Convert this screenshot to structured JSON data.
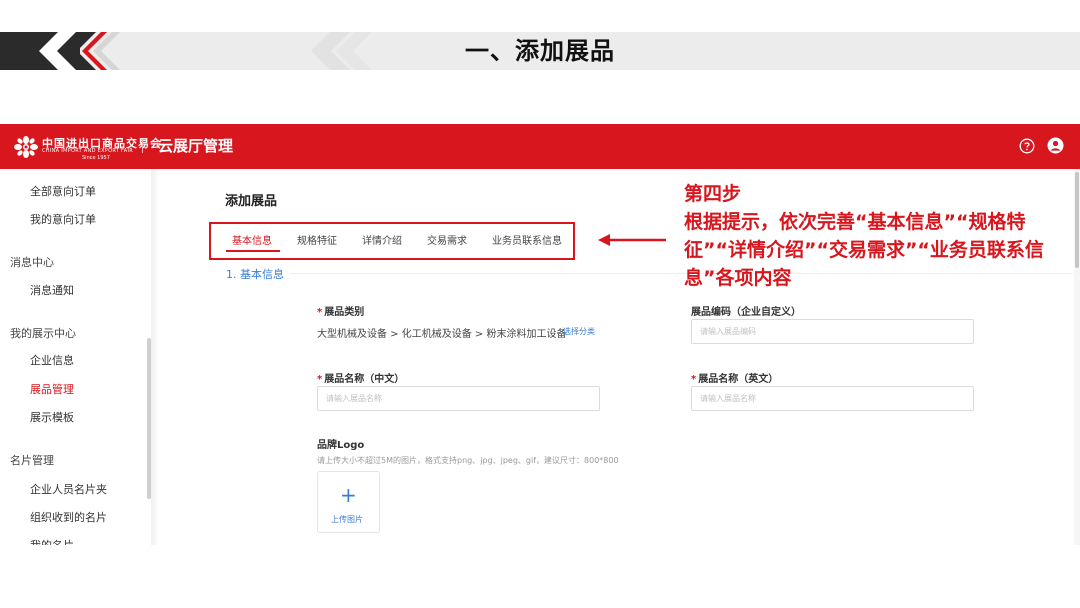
{
  "slide": {
    "title": "一、添加展品"
  },
  "topbar": {
    "logo_cn": "中国进出口商品交易会",
    "logo_en": "CHINA IMPORT AND EXPORT FAIR",
    "logo_since": "Since 1957",
    "app_title": "云展厅管理",
    "help_icon": "question-circle-icon",
    "user_icon": "user-circle-icon"
  },
  "sidebar": {
    "items": [
      {
        "label": "全部意向订单",
        "type": "item"
      },
      {
        "label": "我的意向订单",
        "type": "item"
      },
      {
        "label": "消息中心",
        "type": "group"
      },
      {
        "label": "消息通知",
        "type": "item"
      },
      {
        "label": "我的展示中心",
        "type": "group"
      },
      {
        "label": "企业信息",
        "type": "item"
      },
      {
        "label": "展品管理",
        "type": "item",
        "active": true
      },
      {
        "label": "展示模板",
        "type": "item"
      },
      {
        "label": "名片管理",
        "type": "group"
      },
      {
        "label": "企业人员名片夹",
        "type": "item"
      },
      {
        "label": "组织收到的名片",
        "type": "item"
      },
      {
        "label": "我的名片",
        "type": "item"
      }
    ]
  },
  "main": {
    "page_title": "添加展品",
    "tabs": [
      {
        "label": "基本信息",
        "active": true
      },
      {
        "label": "规格特征"
      },
      {
        "label": "详情介绍"
      },
      {
        "label": "交易需求"
      },
      {
        "label": "业务员联系信息"
      }
    ],
    "section_title": "1. 基本信息",
    "category": {
      "label": "展品类别",
      "path": "大型机械及设备 > 化工机械及设备 > 粉末涂料加工设备",
      "link": "选择分类"
    },
    "code": {
      "label": "展品编码（企业自定义）",
      "placeholder": "请输入展品编码"
    },
    "name_cn": {
      "label": "展品名称（中文）",
      "placeholder": "请输入展品名称"
    },
    "name_en": {
      "label": "展品名称（英文）",
      "placeholder": "请输入展品名称"
    },
    "logo": {
      "label": "品牌Logo",
      "hint": "请上传大小不超过5M的图片，格式支持png、jpg、jpeg、gif，建议尺寸：800*800",
      "upload_label": "上传图片"
    }
  },
  "annotation": {
    "step": "第四步",
    "text": "根据提示，依次完善“基本信息”“规格特征”“详情介绍”“交易需求”“业务员联系信息”各项内容"
  },
  "colors": {
    "brand_red": "#d7161e",
    "link_blue": "#3a7bd5"
  }
}
